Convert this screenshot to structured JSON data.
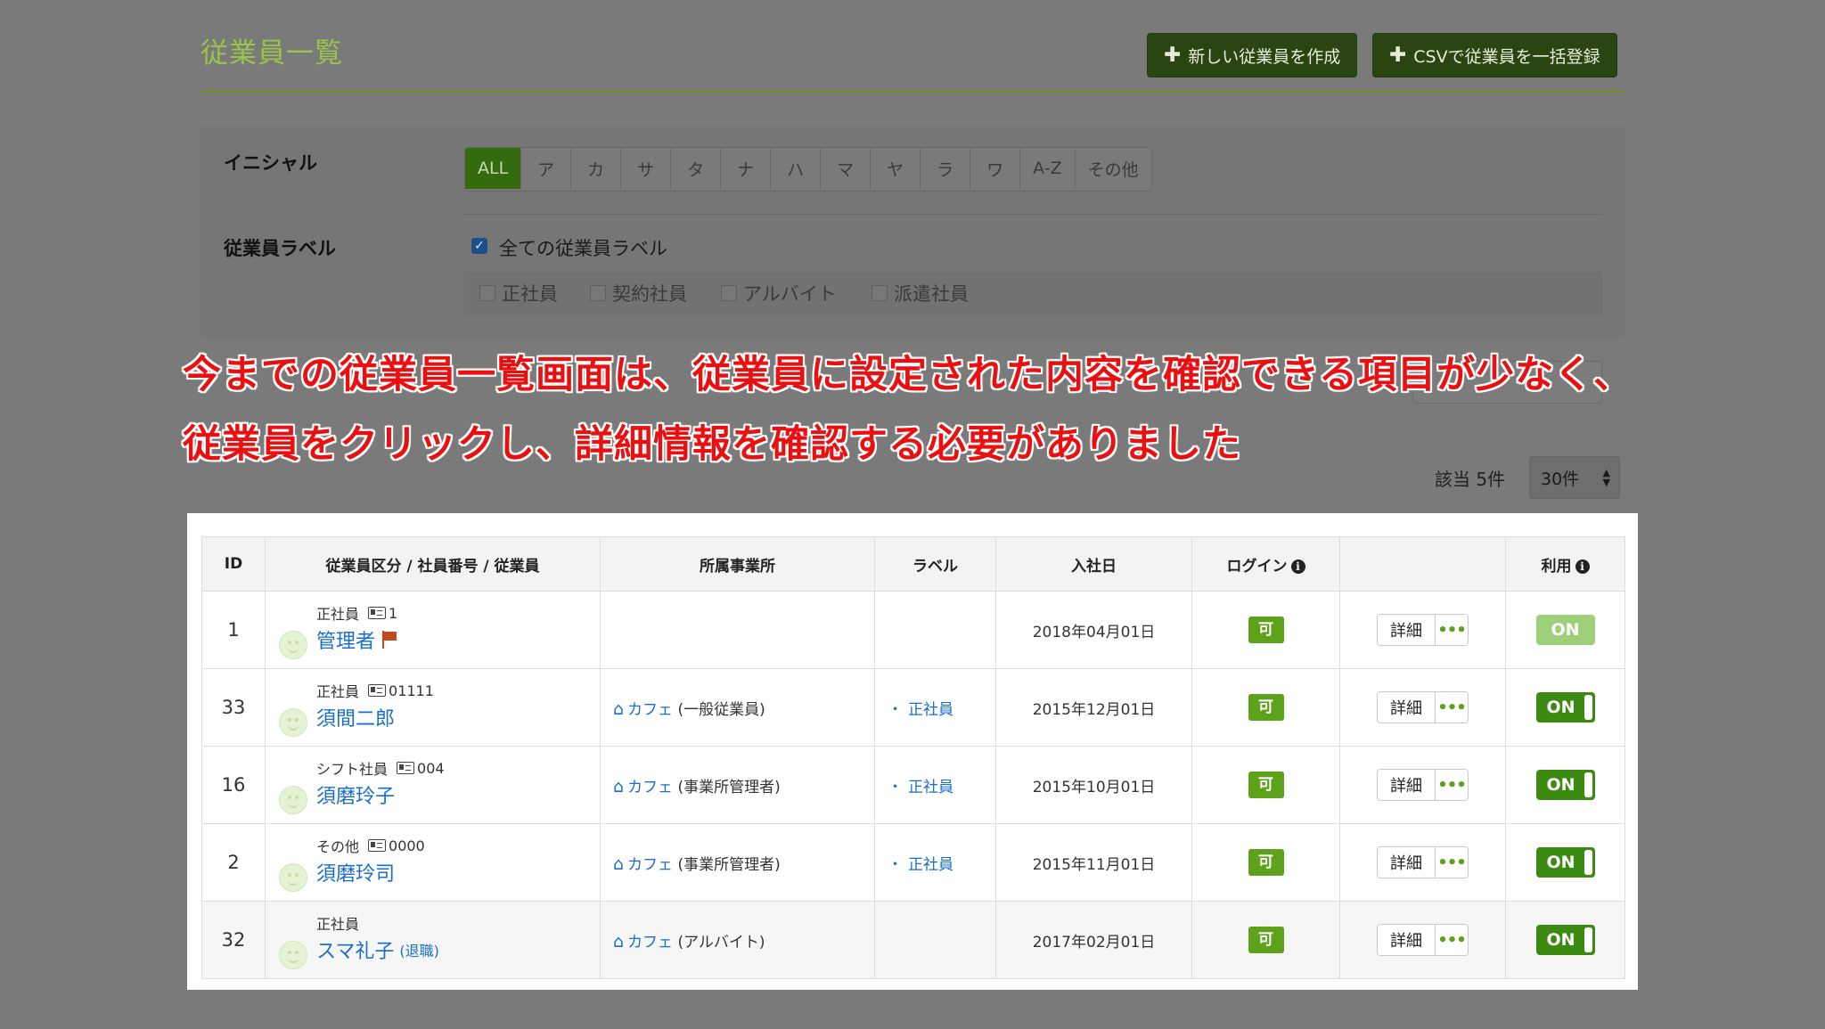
{
  "header": {
    "title": "従業員一覧",
    "buttons": {
      "new_employee": "新しい従業員を作成",
      "csv_import": "CSVで従業員を一括登録"
    }
  },
  "filters": {
    "initial_label": "イニシャル",
    "initials": [
      "ALL",
      "ア",
      "カ",
      "サ",
      "タ",
      "ナ",
      "ハ",
      "マ",
      "ヤ",
      "ラ",
      "ワ",
      "A-Z",
      "その他"
    ],
    "employee_label_title": "従業員ラベル",
    "all_labels_text": "全ての従業員ラベル",
    "labels": [
      "正社員",
      "契約社員",
      "アルバイト",
      "派遣社員"
    ],
    "search_button_partial": "…"
  },
  "annotation": {
    "line1": "今までの従業員一覧画面は、従業員に設定された内容を確認できる項目が少なく、",
    "line2": "従業員をクリックし、詳細情報を確認する必要がありました"
  },
  "result": {
    "count_text": "該当 5件",
    "per_page": "30件"
  },
  "table": {
    "headers": {
      "id": "ID",
      "employee": "従業員区分 / 社員番号 / 従業員",
      "office": "所属事業所",
      "label": "ラベル",
      "hire_date": "入社日",
      "login": "ログイン",
      "actions": "",
      "usage": "利用"
    },
    "detail_label": "詳細",
    "more_label": "•••",
    "rows": [
      {
        "id": "1",
        "type": "正社員",
        "number": "1",
        "name": "管理者",
        "retired": "",
        "office": "",
        "office_role": "",
        "label": "",
        "hire_date": "2018年04月01日",
        "login": "可",
        "usage": "ON"
      },
      {
        "id": "33",
        "type": "正社員",
        "number": "01111",
        "name": "須間二郎",
        "retired": "",
        "office": "カフェ",
        "office_role": "(一般従業員)",
        "label": "正社員",
        "hire_date": "2015年12月01日",
        "login": "可",
        "usage": "ON"
      },
      {
        "id": "16",
        "type": "シフト社員",
        "number": "004",
        "name": "須磨玲子",
        "retired": "",
        "office": "カフェ",
        "office_role": "(事業所管理者)",
        "label": "正社員",
        "hire_date": "2015年10月01日",
        "login": "可",
        "usage": "ON"
      },
      {
        "id": "2",
        "type": "その他",
        "number": "0000",
        "name": "須磨玲司",
        "retired": "",
        "office": "カフェ",
        "office_role": "(事業所管理者)",
        "label": "正社員",
        "hire_date": "2015年11月01日",
        "login": "可",
        "usage": "ON"
      },
      {
        "id": "32",
        "type": "正社員",
        "number": "",
        "name": "スマ礼子",
        "retired": "(退職)",
        "office": "カフェ",
        "office_role": "(アルバイト)",
        "label": "",
        "hire_date": "2017年02月01日",
        "login": "可",
        "usage": "ON"
      }
    ]
  }
}
